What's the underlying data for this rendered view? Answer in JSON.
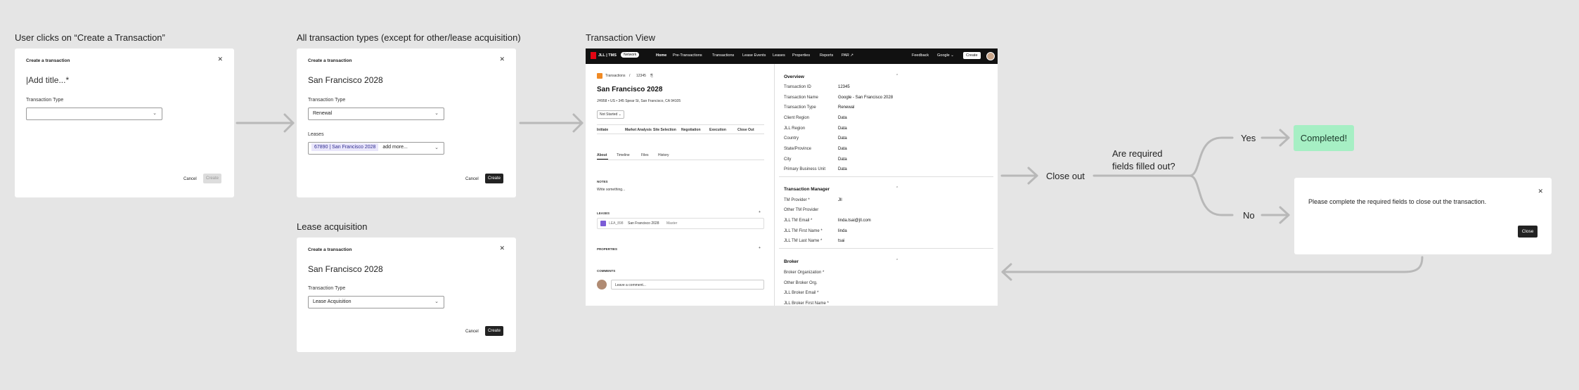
{
  "sections": {
    "s1": "User clicks on “Create a Transaction”",
    "s2": "All transaction types (except for other/lease acquisition)",
    "s3": "Transaction View",
    "s4": "Lease acquisition"
  },
  "modal1": {
    "header": "Create a transaction",
    "title_placeholder": "|Add title...*",
    "type_label": "Transaction Type",
    "type_value": "",
    "cancel": "Cancel",
    "create": "Create"
  },
  "modal2": {
    "header": "Create a transaction",
    "title": "San Francisco 2028",
    "type_label": "Transaction Type",
    "type_value": "Renewal",
    "leases_label": "Leases",
    "lease_chip": "67890 | San Francisco 2028",
    "add_more": "add more...",
    "cancel": "Cancel",
    "create": "Create"
  },
  "modal3": {
    "header": "Create a transaction",
    "title": "San Francisco 2028",
    "type_label": "Transaction Type",
    "type_value": "Lease Acquisition",
    "cancel": "Cancel",
    "create": "Create"
  },
  "tv": {
    "logo": "JLL | TMS",
    "badge": "Network",
    "nav": [
      "Home",
      "Pre-Transactions",
      "Transactions",
      "Lease Events",
      "Leases",
      "Properties",
      "Reports",
      "PAR ↗"
    ],
    "feedback": "Feedback",
    "account": "Google ⌄",
    "create": "Create",
    "breadcrumb": [
      "Transactions",
      "/",
      "12345"
    ],
    "title": "San Francisco 2028",
    "subtitle": "JH958 • US • 345 Spear St, San Francisco, CA 94105",
    "status": "Not Started ⌄",
    "stages": [
      "Initiate",
      "Market Analysis",
      "Site Selection",
      "Negotiation",
      "Execution",
      "Close Out"
    ],
    "tabs": [
      "About",
      "Timeline",
      "Files",
      "History"
    ],
    "notes_label": "NOTES",
    "notes_placeholder": "Write something...",
    "leases_label": "LEASES",
    "lease_row": [
      "LEA_898",
      "San Francisco 2028",
      "Master"
    ],
    "properties_label": "PROPERTIES",
    "comments_label": "COMMENTS",
    "comment_placeholder": "Leave a comment...",
    "overview": {
      "header": "Overview",
      "rows": [
        {
          "label": "Transaction ID",
          "value": "12345"
        },
        {
          "label": "Transaction Name",
          "value": "Google - San Francisco 2028"
        },
        {
          "label": "Transaction Type",
          "value": "Renewal"
        },
        {
          "label": "Client Region",
          "value": "Data"
        },
        {
          "label": "JLL Region",
          "value": "Data"
        },
        {
          "label": "Country",
          "value": "Data"
        },
        {
          "label": "State/Province",
          "value": "Data"
        },
        {
          "label": "City",
          "value": "Data"
        },
        {
          "label": "Primary Business Unit",
          "value": "Data"
        }
      ]
    },
    "tm": {
      "header": "Transaction Manager",
      "rows": [
        {
          "label": "TM Provider *",
          "value": "Jll"
        },
        {
          "label": "Other TM Provider",
          "value": ""
        },
        {
          "label": "JLL TM Email *",
          "value": "linda.tsai@jll.com"
        },
        {
          "label": "JLL TM First Name *",
          "value": "linda"
        },
        {
          "label": "JLL TM Last Name *",
          "value": "tsai"
        }
      ]
    },
    "broker": {
      "header": "Broker",
      "rows": [
        "Broker Organization *",
        "Other Broker Org.",
        "JLL Broker Email *",
        "JLL Broker First Name *"
      ]
    }
  },
  "flow": {
    "close_out": "Close out",
    "question": "Are required\nfields filled out?",
    "yes": "Yes",
    "no": "No",
    "completed": "Completed!",
    "dialog_text": "Please complete the required fields to close out the transaction.",
    "dialog_close": "Close"
  },
  "colors": {
    "completed_bg": "#a6efc4",
    "arrow": "#b5b5b5",
    "chip_bg": "#e9e6fb",
    "brand_red": "#e30613"
  }
}
